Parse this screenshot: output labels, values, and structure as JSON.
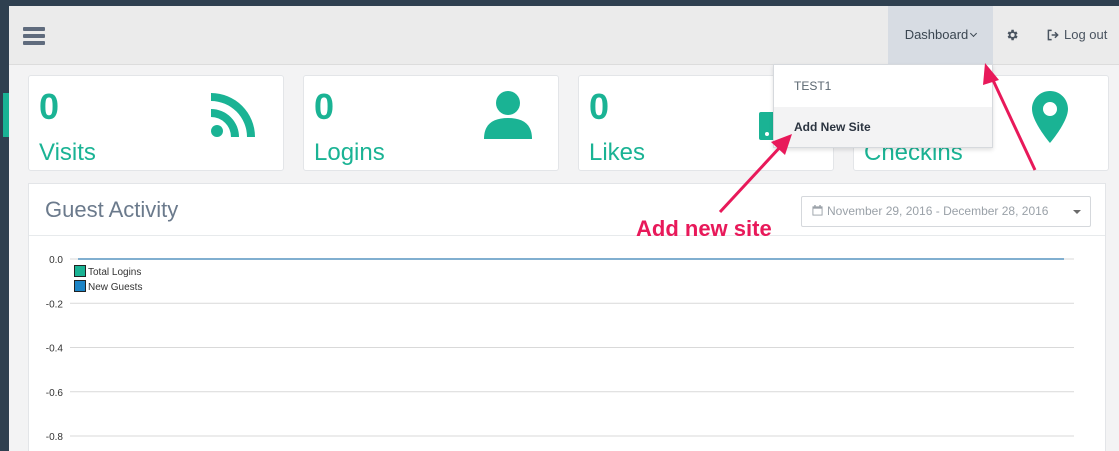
{
  "topbar": {
    "menu_icon": "hamburger-menu-icon",
    "dashboard_label": "Dashboard",
    "settings_icon": "gear-icon",
    "logout_label": "Log out",
    "logout_icon": "sign-out-icon"
  },
  "stats": [
    {
      "value": "0",
      "label": "Visits",
      "icon": "rss-icon"
    },
    {
      "value": "0",
      "label": "Logins",
      "icon": "user-icon"
    },
    {
      "value": "0",
      "label": "Likes",
      "icon": "mobile-phone-icon"
    },
    {
      "value": "0",
      "label": "Checkins",
      "icon": "map-marker-icon"
    }
  ],
  "guest_activity": {
    "title": "Guest Activity",
    "date_range": "November 29, 2016 - December 28, 2016",
    "date_icon": "calendar-icon"
  },
  "chart_data": {
    "type": "line",
    "y_ticks": [
      "0.0",
      "-0.2",
      "-0.4",
      "-0.6",
      "-0.8"
    ],
    "ylim": [
      -0.8,
      0.0
    ],
    "series": [
      {
        "name": "Total Logins",
        "color": "#1ab394",
        "values": [
          0,
          0
        ]
      },
      {
        "name": "New Guests",
        "color": "#1c84c6",
        "values": [
          0,
          0
        ]
      }
    ],
    "grid": true,
    "legend": "top-left"
  },
  "dropdown": {
    "items": [
      {
        "label": "TEST1",
        "active": false
      },
      {
        "label": "Add New Site",
        "active": true
      }
    ]
  },
  "annotation": {
    "text": "Add new site",
    "color": "#e8195a"
  },
  "colors": {
    "accent": "#1ab394",
    "sidebar": "#2f4050"
  }
}
